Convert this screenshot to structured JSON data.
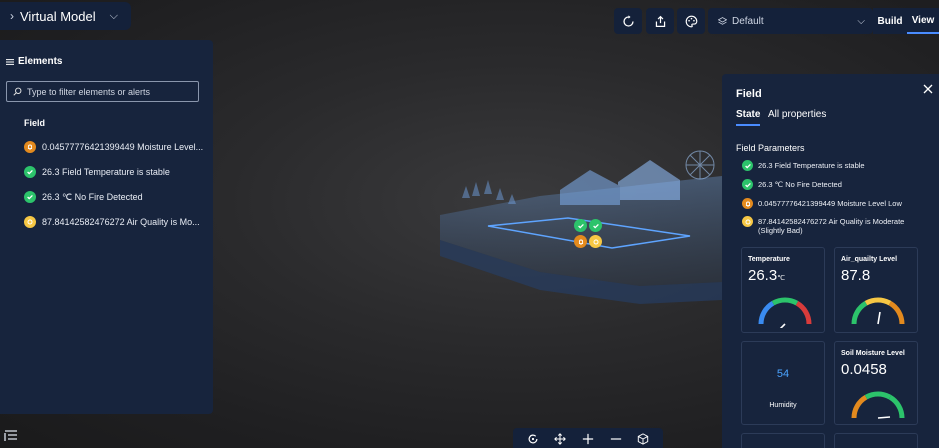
{
  "topbar": {
    "title": "Virtual Model",
    "scene_selector": "Default",
    "tabs": [
      "Build",
      "View"
    ]
  },
  "elements_panel": {
    "title": "Elements",
    "search_placeholder": "Type to filter elements or alerts",
    "group": "Field",
    "items": [
      {
        "status": "alert",
        "text": "0.04577776421399449 Moisture Level..."
      },
      {
        "status": "ok",
        "text": "26.3 Field Temperature is stable"
      },
      {
        "status": "ok",
        "text": "26.3 ℃ No Fire Detected"
      },
      {
        "status": "warning",
        "text": "87.84142582476272 Air Quality is Mo..."
      }
    ]
  },
  "field_panel": {
    "title": "Field",
    "tabs": [
      "State",
      "All properties"
    ],
    "active_tab": "State",
    "section": "Field Parameters",
    "parameters": [
      {
        "status": "ok",
        "text": "26.3 Field Temperature is stable"
      },
      {
        "status": "ok",
        "text": "26.3 ℃ No Fire Detected"
      },
      {
        "status": "alert",
        "text": "0.04577776421399449 Moisture Level Low"
      },
      {
        "status": "warning",
        "text": "87.84142582476272 Air Quality is Moderate (Slightly Bad)"
      }
    ],
    "cards": {
      "temperature": {
        "title": "Temperature",
        "value": "26.3",
        "unit": "℃",
        "gauge_fraction": 0.55
      },
      "air_quality": {
        "title": "Air_quailty Level",
        "value": "87.8",
        "gauge_fraction": 0.5
      },
      "humidity": {
        "title": "Humidity",
        "value": "54"
      },
      "soil_moisture": {
        "title": "Soil Moisture Level",
        "value": "0.0458",
        "gauge_fraction": 0.04
      }
    }
  },
  "colors": {
    "panel_bg": "#17243d",
    "ok": "#2cc36b",
    "alert": "#e38a1e",
    "warning": "#f6c744",
    "accent": "#4a8cff"
  },
  "icons": {
    "topbar": [
      "refresh-icon",
      "share-icon",
      "palette-icon",
      "scene-icon"
    ],
    "bottom_toolbar": [
      "orbit-icon",
      "pan-icon",
      "zoom-in-icon",
      "zoom-out-icon",
      "cube-view-icon"
    ]
  }
}
